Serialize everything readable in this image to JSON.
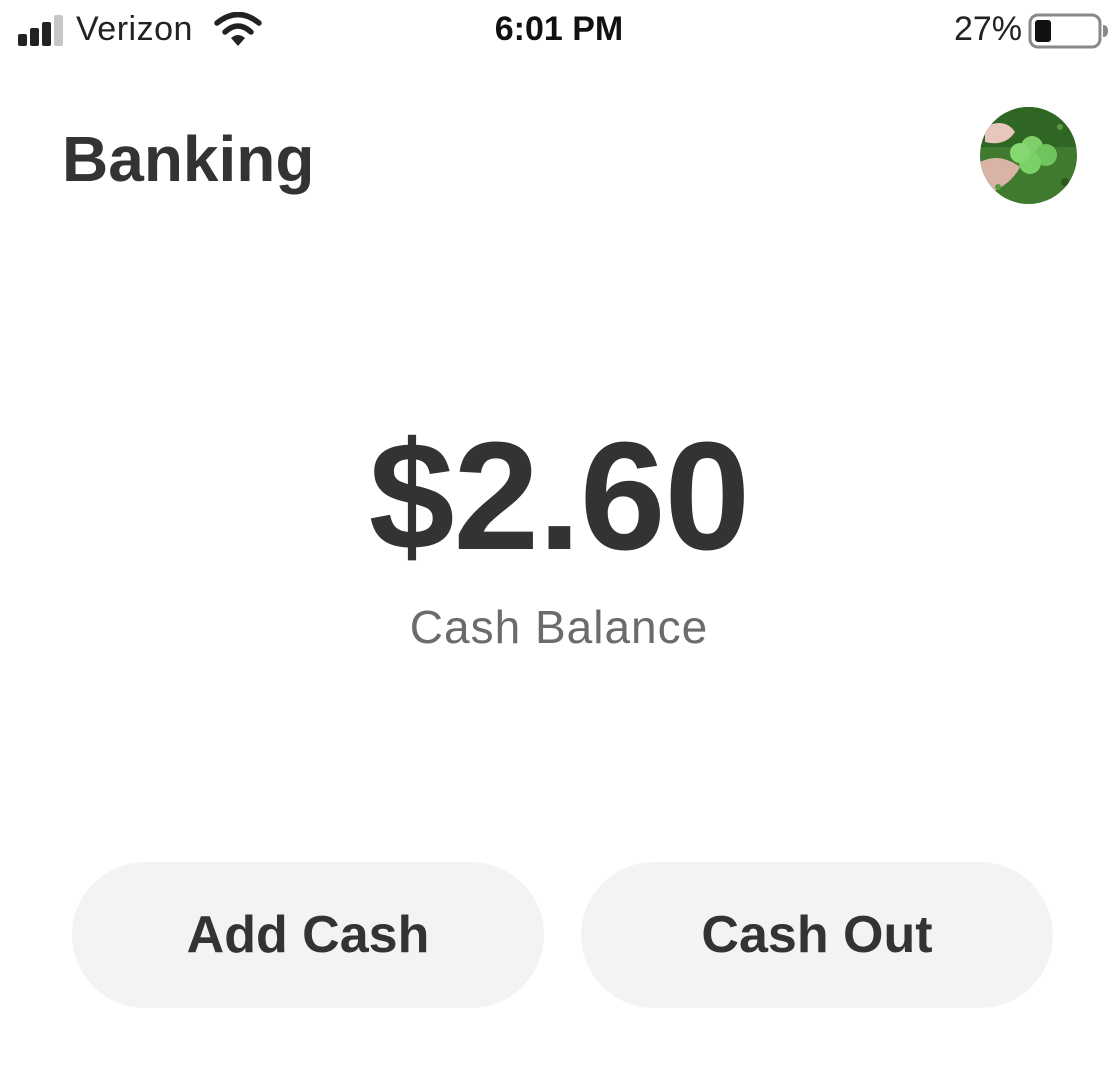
{
  "status_bar": {
    "carrier": "Verizon",
    "time": "6:01 PM",
    "battery_percent": "27%",
    "battery_level": 0.27,
    "signal_bars_active": 3,
    "signal_bars_total": 4,
    "icons": [
      "signal-icon",
      "wifi-icon",
      "battery-icon"
    ]
  },
  "header": {
    "title": "Banking",
    "avatar_icon": "profile-avatar"
  },
  "balance": {
    "amount": "$2.60",
    "label": "Cash Balance"
  },
  "actions": {
    "add_cash_label": "Add Cash",
    "cash_out_label": "Cash Out"
  },
  "colors": {
    "text": "#333333",
    "muted": "#6b6b6b",
    "button_bg": "#f3f3f3",
    "background": "#ffffff"
  }
}
